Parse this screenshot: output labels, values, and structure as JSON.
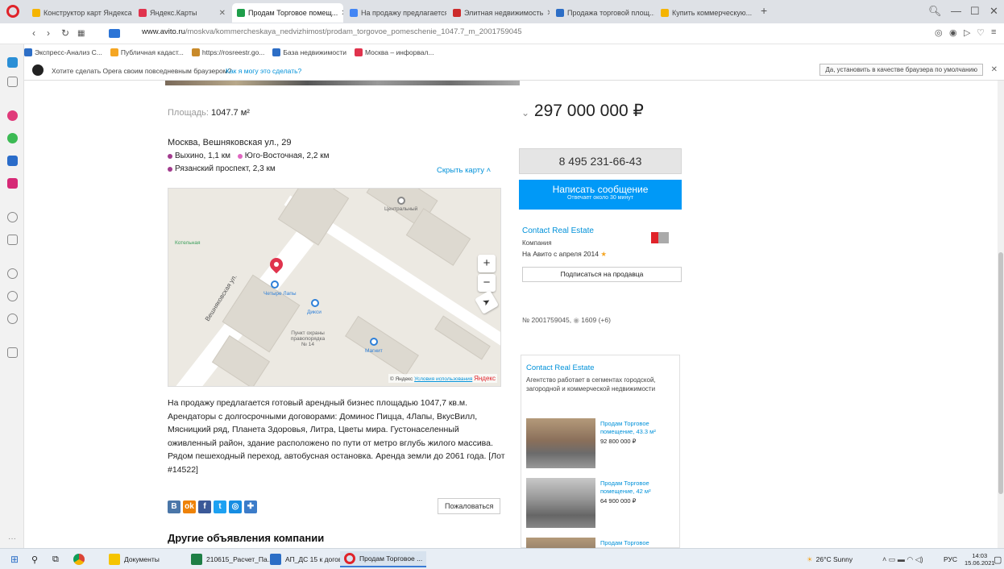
{
  "browser": {
    "tabs": [
      {
        "label": "Конструктор карт Яндекса",
        "color": "#f5b400"
      },
      {
        "label": "Яндекс.Карты",
        "color": "#e0334d"
      },
      {
        "label": "Продам Торговое помещ...",
        "color": "#1e9e4a"
      },
      {
        "label": "На продажу предлагается...",
        "color": "#4285f4"
      },
      {
        "label": "Элитная недвижимость",
        "color": "#cc2b2b"
      },
      {
        "label": "Продажа торговой площ...",
        "color": "#2d6ec6"
      },
      {
        "label": "Купить коммерческую...",
        "color": "#f5b400"
      }
    ],
    "new_tab": "+",
    "url_host": "www.avito.ru",
    "url_path": "/moskva/kommercheskaya_nedvizhimost/prodam_torgovoe_pomeschenie_1047.7_m_2001759045",
    "bookmarks": [
      {
        "label": "Экспресс-Анализ С...",
        "color": "#2d6ec6"
      },
      {
        "label": "Публичная кадаст...",
        "color": "#f5a623"
      },
      {
        "label": "https://rosreestr.go...",
        "color": "#c98a2a"
      },
      {
        "label": "База недвижимости",
        "color": "#2d6ec6"
      },
      {
        "label": "Москва – инфорвал...",
        "color": "#e0334d"
      }
    ],
    "notice": "Хотите сделать Opera своим повседневным браузером?",
    "notice_link": "Как я могу это сделать?",
    "notice_button": "Да, установить в качестве браузера по умолчанию"
  },
  "listing": {
    "area_label": "Площадь:",
    "area_value": "1047.7 м²",
    "address": "Москва, Вешняковская ул., 29",
    "metro": [
      {
        "name": "Выхино, 1,1 км",
        "color": "#a23b8e"
      },
      {
        "name": "Юго-Восточная, 2,2 км",
        "color": "#e066c1"
      },
      {
        "name": "Рязанский проспект, 2,3 км",
        "color": "#a23b8e"
      }
    ],
    "hide_map": "Скрыть карту",
    "map": {
      "street": "Вешняковская ул.",
      "poi1": "Четыре Лапы",
      "poi2": "Дикси",
      "poi3": "Магнит",
      "poi4": "Пункт охраны правопорядка № 14",
      "poi5": "Центральный",
      "poi6": "Котельная",
      "copyright": "© Яндекс",
      "terms": "Условия использования",
      "brand": "Яндекс",
      "zoom_in": "+",
      "zoom_out": "−",
      "locate": "➤"
    },
    "description": "На продажу предлагается готовый арендный бизнес площадью 1047,7 кв.м. Арендаторы с долгосрочными договорами: Доминос Пицца, 4Лапы, ВкусВилл, Мясницкий ряд, Планета Здоровья, Литра, Цветы мира. Густонаселенный оживленный район, здание расположено по пути от метро вглубь жилого массива. Рядом пешеходный переход, автобусная остановка. Аренда земли до 2061 года. [Лот #14522]",
    "complain": "Пожаловаться",
    "other_ads": "Другие объявления компании",
    "social": [
      "В",
      "ok",
      "f",
      "t",
      "◎",
      "✚"
    ]
  },
  "sidebar_right": {
    "price": "297 000 000 ₽",
    "phone": "8 495 231-66-43",
    "write": "Написать сообщение",
    "reply_time": "Отвечает около 30 минут",
    "seller": "Contact Real Estate",
    "seller_type": "Компания",
    "since": "На Авито с апреля 2014",
    "subscribe": "Подписаться на продавца",
    "ad_no": "№ 2001759045,",
    "views": "1609 (+6)",
    "card_title": "Contact Real Estate",
    "card_text": "Агентство работает в сегментах городской, загородной и коммерческой недвижимости",
    "ads": [
      {
        "title": "Продам Торговое помещение, 43.3 м²",
        "price": "92 800 000 ₽"
      },
      {
        "title": "Продам Торговое помещение, 42 м²",
        "price": "64 900 000 ₽"
      },
      {
        "title": "Продам Торговое",
        "price": ""
      }
    ]
  },
  "taskbar": {
    "items": [
      {
        "label": "Документы",
        "color": "#f5c400"
      },
      {
        "label": "210615_Расчет_Па...",
        "color": "#1e7e45"
      },
      {
        "label": "АП_ДС 15 к договор...",
        "color": "#2b6ec6"
      },
      {
        "label": "Продам Торговое ...",
        "color": "#e0232a"
      }
    ],
    "weather": "26°C Sunny",
    "lang": "РУС",
    "time": "14:03",
    "date": "15.06.2021"
  }
}
